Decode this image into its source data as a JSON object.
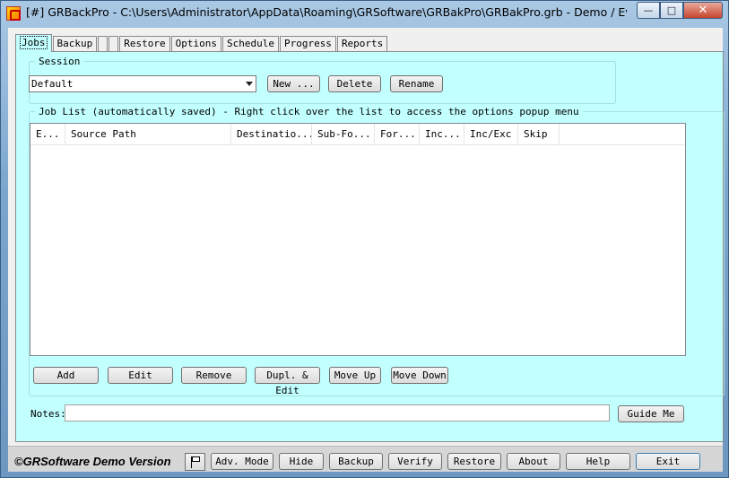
{
  "window": {
    "title": "[#] GRBackPro - C:\\Users\\Administrator\\AppData\\Roaming\\GRSoftware\\GRBakPro\\GRBakPro.grb - Demo / Evaluat...",
    "minimize": "—",
    "maximize": "□",
    "close": "✕"
  },
  "tabs": [
    {
      "label": "Jobs"
    },
    {
      "label": "Backup"
    },
    {
      "label": ""
    },
    {
      "label": ""
    },
    {
      "label": "Restore"
    },
    {
      "label": "Options"
    },
    {
      "label": "Schedule"
    },
    {
      "label": "Progress"
    },
    {
      "label": "Reports"
    }
  ],
  "session": {
    "legend": "Session",
    "selected": "Default",
    "new_label": "New ...",
    "delete_label": "Delete",
    "rename_label": "Rename"
  },
  "joblist": {
    "legend": "Job List (automatically saved) - Right click over the list to access the options popup menu",
    "columns": [
      "E...",
      "Source Path",
      "Destinatio...",
      "Sub-Fo...",
      "For...",
      "Inc...",
      "Inc/Exc",
      "Skip"
    ],
    "rows": [],
    "buttons": {
      "add": "Add",
      "edit": "Edit",
      "remove": "Remove",
      "dupl": "Dupl. & Edit",
      "move_up": "Move Up",
      "move_down": "Move Down"
    }
  },
  "notes": {
    "label": "Notes:",
    "value": "",
    "guide_me": "Guide Me"
  },
  "bottom": {
    "copyright": "©GRSoftware Demo Version",
    "adv_mode": "Adv. Mode",
    "hide": "Hide",
    "backup": "Backup",
    "verify": "Verify",
    "restore": "Restore",
    "about": "About",
    "help": "Help",
    "exit": "Exit"
  },
  "colors": {
    "panel_bg": "#c2ffff",
    "window_frame": "#7aa6cd"
  }
}
